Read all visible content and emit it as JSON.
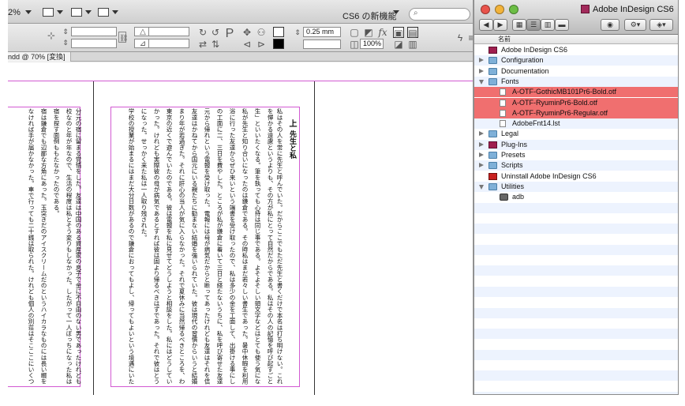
{
  "indesign": {
    "zoom_label": "2%",
    "search_label": "CS6 の新機能",
    "search_placeholder": "",
    "stroke_weight": "0.25 mm",
    "opacity": "100%",
    "doc_tab": "ndd @ 70% [変換]"
  },
  "document": {
    "right_page_heading": "上",
    "right_page_subheading": "先生と私",
    "right_page_columns": [
      "私はその人を常に先生と呼んでいた。だからここでもただ先生と書くだけで本名は打ち明けない。これは世間",
      "を憚かる遠慮というよりも、その方が私にとって自然だからである。私はその人の記憶を呼び起すごとに、すぐ「先",
      "生」といいたくなる。筆を執っても心持は同じ事である。よそよそしい頭文字などはとても使う気にならない。",
      "私が先生と知り合いになったのは鎌倉である。その時私はまだ若々しい書生であった。暑中休暇を利用して海水",
      "浴に行った友達からぜひ来いという端書を受け取ったので、私は多少の金を工面して、出掛ける事にした。私は金",
      "の工面に二、三日を費やした。ところが私が鎌倉に着いて三日と経たないうちに、私を呼び寄せた友達は、急に国",
      "元から帰れという電報を受け取った。電報には母が病気だからと断ってあったけれども友達はそれを信じなかった。",
      "友達はかねてから国元にいる親たちに勧まない結婚を強いられていた。彼は現代の習慣からいうと結婚するにはあ",
      "まり年が若過ぎた。それに肝心の当人が気に入らなかった。それで夏休みに当然帰るべきところを、わざと避けて",
      "東京の近くで遊んでいたのである。彼は電報を私に見せてどうしようと相談をした。私にはどうしていいか分らな",
      "かった。けれども実際彼の母が病気であるとすれば彼は固より帰るべきはずであった。それで彼はとうとう帰る事",
      "になった。せっかく来た私は一人取り残された。",
      "学校の授業が始まるにはまだ大分日数があるので鎌倉におってもよし、帰ってもよいという境遇にいた私は、当"
    ],
    "left_page_columns": [
      "分元の宿に留まる覚悟をした。友達は中国のある資産家の息子で金に不自由のない男であったけれども、学校が学",
      "校なのと年が年なので、生活の程度は私とそう変りもしなかった。したがって一人ぼっちになった私は別に恰好な",
      "宿を探す面倒ももたなかったのである。",
      "宿は鎌倉でも辺鄙な方角にあった。玉突きだのアイスクリームだのというハイカラなものには長い畷を一つ越さ",
      "なければ手が届かなかった。車で行っても二十銭は取られた。けれども個人の別荘はそこここにいくつでも建てら",
      "れていた。それに海へはごく近いので海水浴をやるには至極便利な地位を占めていた。",
      "私は毎日海へはいりに出掛けた。古い燻ぶり返った藁葺の間を通り抜けて磯へ下りると、この辺にこれほどの都"
    ]
  },
  "finder": {
    "title": "Adobe InDesign CS6",
    "column_header": "名前",
    "rows": [
      {
        "label": "Adobe InDesign CS6",
        "indent": 0,
        "icon": "app",
        "disclosure": "none",
        "selected": false
      },
      {
        "label": "Configuration",
        "indent": 0,
        "icon": "folder",
        "disclosure": "closed",
        "selected": false
      },
      {
        "label": "Documentation",
        "indent": 0,
        "icon": "folder",
        "disclosure": "closed",
        "selected": false
      },
      {
        "label": "Fonts",
        "indent": 0,
        "icon": "folder",
        "disclosure": "open",
        "selected": false
      },
      {
        "label": "A-OTF-GothicMB101Pr6-Bold.otf",
        "indent": 1,
        "icon": "file",
        "disclosure": "none",
        "selected": true
      },
      {
        "label": "A-OTF-RyuminPr6-Bold.otf",
        "indent": 1,
        "icon": "file",
        "disclosure": "none",
        "selected": true
      },
      {
        "label": "A-OTF-RyuminPr6-Regular.otf",
        "indent": 1,
        "icon": "file",
        "disclosure": "none",
        "selected": true
      },
      {
        "label": "AdobeFnt14.lst",
        "indent": 1,
        "icon": "file",
        "disclosure": "none",
        "selected": false
      },
      {
        "label": "Legal",
        "indent": 0,
        "icon": "folder",
        "disclosure": "closed",
        "selected": false
      },
      {
        "label": "Plug-Ins",
        "indent": 0,
        "icon": "app",
        "disclosure": "closed",
        "selected": false
      },
      {
        "label": "Presets",
        "indent": 0,
        "icon": "folder",
        "disclosure": "closed",
        "selected": false
      },
      {
        "label": "Scripts",
        "indent": 0,
        "icon": "folder",
        "disclosure": "closed",
        "selected": false
      },
      {
        "label": "Uninstall Adobe InDesign CS6",
        "indent": 0,
        "icon": "app-red",
        "disclosure": "none",
        "selected": false
      },
      {
        "label": "Utilities",
        "indent": 0,
        "icon": "folder",
        "disclosure": "open",
        "selected": false
      },
      {
        "label": "adb",
        "indent": 1,
        "icon": "disk",
        "disclosure": "none",
        "selected": false
      }
    ]
  },
  "colors": {
    "selection": "#f06f6f",
    "margin_guide": "#d25ad2",
    "alt_row": "#edf3fe"
  }
}
